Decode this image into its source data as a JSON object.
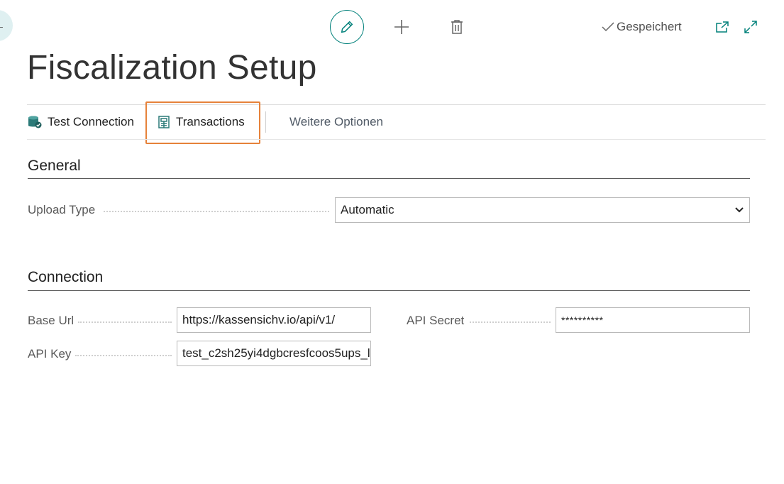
{
  "header": {
    "back_glyph": "←",
    "status": "Gespeichert",
    "icons": {
      "edit": "edit-pencil-icon",
      "new": "plus-icon",
      "delete": "trash-icon",
      "saved": "checkmark-icon",
      "open_new_window": "open-in-new-window-icon",
      "expand": "expand-icon"
    }
  },
  "page": {
    "title": "Fiscalization Setup"
  },
  "actions": {
    "test_connection": "Test Connection",
    "transactions": "Transactions",
    "more_options": "Weitere Optionen"
  },
  "general": {
    "title": "General",
    "upload_type": {
      "label": "Upload Type",
      "value": "Automatic"
    }
  },
  "connection": {
    "title": "Connection",
    "base_url": {
      "label": "Base Url",
      "value": "https://kassensichv.io/api/v1/"
    },
    "api_key": {
      "label": "API Key",
      "value": "test_c2sh25yi4dgbcresfcoos5ups_l"
    },
    "api_secret": {
      "label": "API Secret",
      "value": "**********"
    }
  },
  "colors": {
    "accent": "#00807a",
    "highlight": "#e6823a"
  }
}
